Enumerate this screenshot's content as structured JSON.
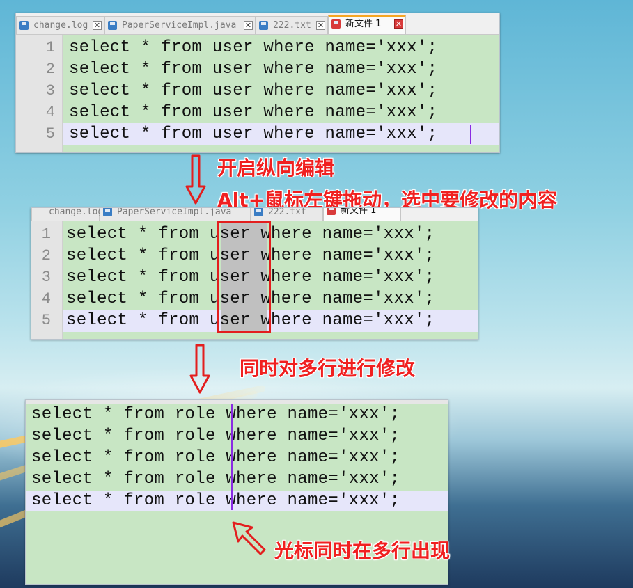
{
  "tabs": [
    {
      "label": "change.log",
      "close": "✕"
    },
    {
      "label": "PaperServiceImpl.java",
      "close": "✕"
    },
    {
      "label": "222.txt",
      "close": "✕"
    },
    {
      "label": "新文件 1",
      "close": "✕"
    }
  ],
  "panel1": {
    "line_numbers": [
      "1",
      "2",
      "3",
      "4",
      "5"
    ],
    "lines": [
      "select * from user where name='xxx';",
      "select * from user where name='xxx';",
      "select * from user where name='xxx';",
      "select * from user where name='xxx';",
      "select * from user where name='xxx';"
    ]
  },
  "panel2": {
    "line_numbers": [
      "1",
      "2",
      "3",
      "4",
      "5"
    ],
    "prefix": "select * from ",
    "selected": "user",
    "suffix": " where name='xxx';"
  },
  "panel3": {
    "lines": [
      "select * from role where name='xxx';",
      "select * from role where name='xxx';",
      "select * from role where name='xxx';",
      "select * from role where name='xxx';",
      "select * from role where name='xxx';"
    ]
  },
  "annotations": {
    "step1_line1": "开启纵向编辑",
    "step1_line2": "Alt+鼠标左键拖动，选中要修改的内容",
    "step2": "同时对多行进行修改",
    "step3": "光标同时在多行出现"
  },
  "colors": {
    "editor_bg": "#c8e6c4",
    "current_line": "#e6e6fa",
    "selection": "#c0c0c0",
    "annotation_red": "#f02020",
    "active_tab_accent": "#f5a623"
  }
}
